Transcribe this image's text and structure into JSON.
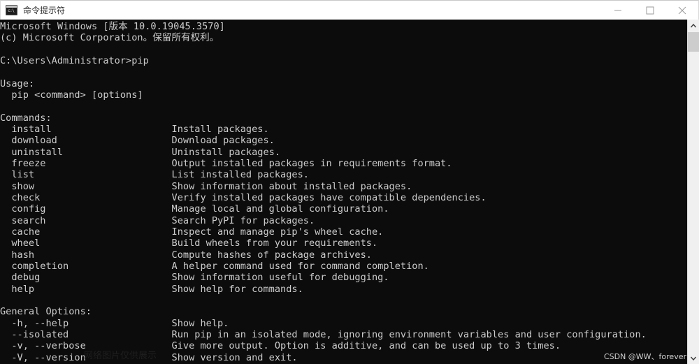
{
  "window": {
    "title": "命令提示符",
    "icon": "console-icon"
  },
  "window_controls": {
    "minimize": "minimize-icon",
    "maximize": "maximize-icon",
    "close": "close-icon"
  },
  "scrollbar": {
    "up_arrow": "chevron-up-icon",
    "down_arrow": "chevron-down-icon"
  },
  "colors": {
    "console_background": "#0c0c0c",
    "console_text": "#cccccc",
    "titlebar_background": "#ffffff",
    "titlebar_text": "#2b2b2b",
    "scrollbar_track": "#f0f0f0",
    "scrollbar_thumb": "#cdcdcd"
  },
  "console": {
    "banner": [
      "Microsoft Windows [版本 10.0.19045.3570]",
      "(c) Microsoft Corporation。保留所有权利。"
    ],
    "prompt_line": "C:\\Users\\Administrator>pip",
    "usage_header": "Usage:",
    "usage_line": "  pip <command> [options]",
    "commands_header": "Commands:",
    "commands": [
      {
        "name": "install",
        "description": "Install packages."
      },
      {
        "name": "download",
        "description": "Download packages."
      },
      {
        "name": "uninstall",
        "description": "Uninstall packages."
      },
      {
        "name": "freeze",
        "description": "Output installed packages in requirements format."
      },
      {
        "name": "list",
        "description": "List installed packages."
      },
      {
        "name": "show",
        "description": "Show information about installed packages."
      },
      {
        "name": "check",
        "description": "Verify installed packages have compatible dependencies."
      },
      {
        "name": "config",
        "description": "Manage local and global configuration."
      },
      {
        "name": "search",
        "description": "Search PyPI for packages."
      },
      {
        "name": "cache",
        "description": "Inspect and manage pip's wheel cache."
      },
      {
        "name": "wheel",
        "description": "Build wheels from your requirements."
      },
      {
        "name": "hash",
        "description": "Compute hashes of package archives."
      },
      {
        "name": "completion",
        "description": "A helper command used for command completion."
      },
      {
        "name": "debug",
        "description": "Show information useful for debugging."
      },
      {
        "name": "help",
        "description": "Show help for commands."
      }
    ],
    "options_header": "General Options:",
    "options": [
      {
        "flag": "-h, --help",
        "description": "Show help."
      },
      {
        "flag": "--isolated",
        "description": "Run pip in an isolated mode, ignoring environment variables and user configuration."
      },
      {
        "flag": "-v, --verbose",
        "description": "Give more output. Option is additive, and can be used up to 3 times."
      },
      {
        "flag": "-V, --version",
        "description": "Show version and exit."
      }
    ]
  },
  "watermarks": {
    "corner": "CSDN @WW、forever",
    "faint": "网络图片仅供展示"
  }
}
